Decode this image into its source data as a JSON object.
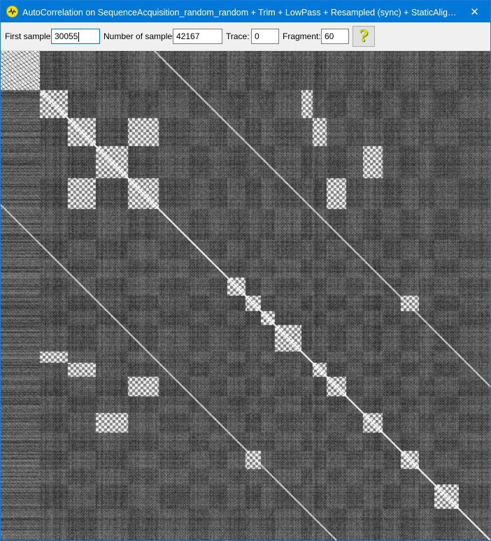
{
  "window": {
    "title": "AutoCorrelation on SequenceAcquisition_random_random + Trim + LowPass + Resampled (sync)  + StaticAlign + Trim + ...",
    "app_icon": "oscilloscope-icon",
    "close_glyph": "✕"
  },
  "toolbar": {
    "first_sample_label": "First sample:",
    "first_sample_value": "30055",
    "num_samples_label": "Number of samples:",
    "num_samples_value": "42167",
    "trace_label": "Trace:",
    "trace_value": "0",
    "fragment_label": "Fragment:",
    "fragment_value": "60",
    "help_glyph": "?",
    "help_icon": "help-question-icon"
  },
  "colors": {
    "titlebar": "#0078d7",
    "heatmap_low": "#2a2a2a",
    "heatmap_high": "#ffffff"
  },
  "heatmap": {
    "type": "autocorrelation-matrix",
    "colormap": "grayscale"
  }
}
